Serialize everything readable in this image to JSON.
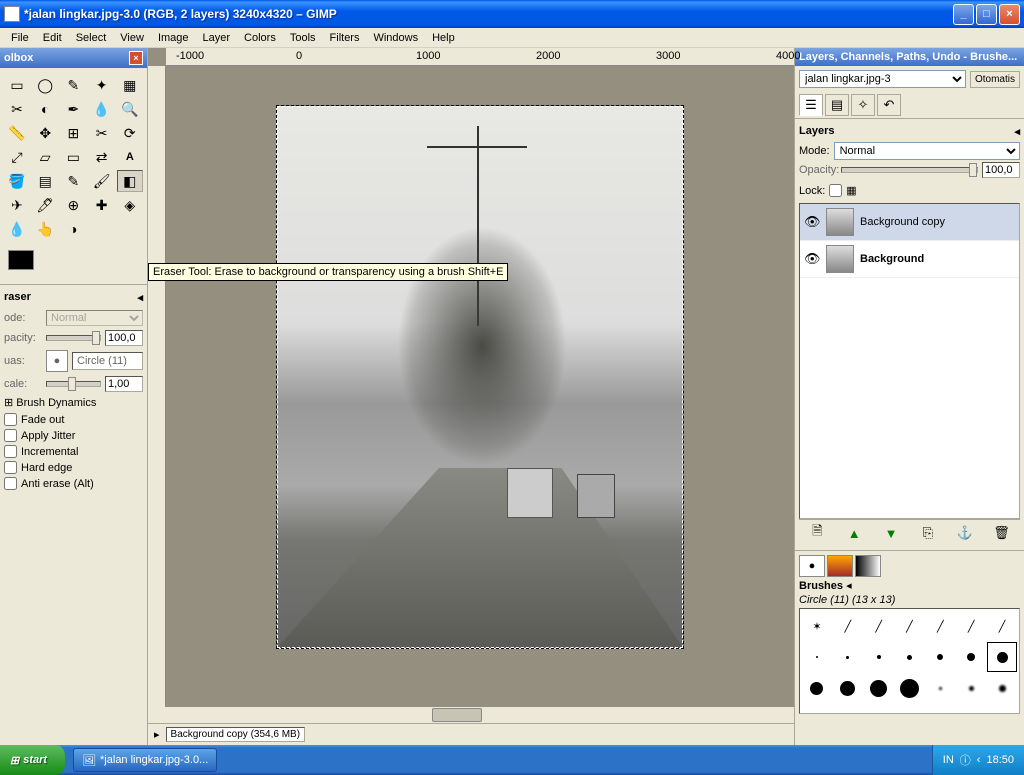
{
  "window": {
    "title": "*jalan lingkar.jpg-3.0 (RGB, 2 layers) 3240x4320 – GIMP"
  },
  "menu": [
    "File",
    "Edit",
    "Select",
    "View",
    "Image",
    "Layer",
    "Colors",
    "Tools",
    "Filters",
    "Windows",
    "Help"
  ],
  "toolbox": {
    "title": "olbox",
    "tooltip": "Eraser Tool: Erase to background or transparency using a brush  Shift+E"
  },
  "tool_options": {
    "title": "raser",
    "mode_label": "ode:",
    "mode_value": "Normal",
    "opacity_label": "pacity:",
    "opacity_value": "100,0",
    "brush_label": "uas:",
    "brush_name": "Circle (11)",
    "scale_label": "cale:",
    "scale_value": "1,00",
    "brush_dynamics": "Brush Dynamics",
    "fade_out": "Fade out",
    "apply_jitter": "Apply Jitter",
    "incremental": "Incremental",
    "hard_edge": "Hard edge",
    "anti_erase": "Anti erase  (Alt)"
  },
  "ruler": [
    "-1000",
    "0",
    "1000",
    "2000",
    "3000",
    "4000"
  ],
  "status_layer": "Background copy (354,6 MB)",
  "layers": {
    "panel_title": "Layers, Channels, Paths, Undo - Brushe...",
    "image_name": "jalan lingkar.jpg-3",
    "auto_btn": "Otomatis",
    "header": "Layers",
    "mode_label": "Mode:",
    "mode_value": "Normal",
    "opacity_label": "Opacity:",
    "opacity_value": "100,0",
    "lock_label": "Lock:",
    "items": [
      {
        "name": "Background copy",
        "visible": true
      },
      {
        "name": "Background",
        "visible": true
      }
    ]
  },
  "brushes": {
    "header": "Brushes",
    "current": "Circle (11) (13 x 13)"
  },
  "taskbar": {
    "start": "start",
    "task": "*jalan lingkar.jpg-3.0...",
    "lang": "IN",
    "time": "18:50"
  }
}
